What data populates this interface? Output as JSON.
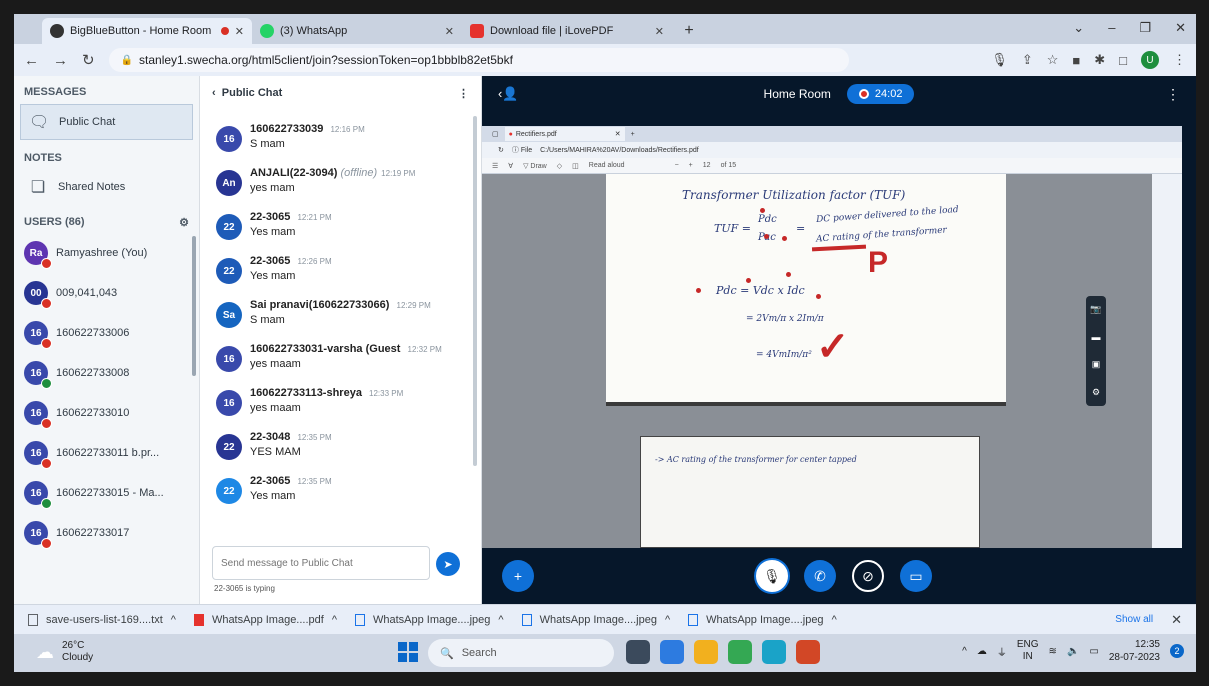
{
  "browser": {
    "tabs": [
      {
        "title": "BigBlueButton - Home Room",
        "active": true,
        "recording": true
      },
      {
        "title": "(3) WhatsApp",
        "active": false
      },
      {
        "title": "Download file | iLovePDF",
        "active": false
      }
    ],
    "url": "stanley1.swecha.org/html5client/join?sessionToken=op1bbblb82et5bkf"
  },
  "sidebar": {
    "messages_title": "MESSAGES",
    "public_chat": "Public Chat",
    "notes_title": "NOTES",
    "shared_notes": "Shared Notes",
    "users_title": "USERS (86)",
    "users": [
      {
        "initials": "Ra",
        "name": "Ramyashree (You)",
        "color": "#5e35b1",
        "mic": "muted"
      },
      {
        "initials": "00",
        "name": "009,041,043",
        "color": "#283593",
        "mic": "muted"
      },
      {
        "initials": "16",
        "name": "160622733006",
        "color": "#3949ab",
        "mic": "muted"
      },
      {
        "initials": "16",
        "name": "160622733008",
        "color": "#3949ab",
        "mic": "listen"
      },
      {
        "initials": "16",
        "name": "160622733010",
        "color": "#3949ab",
        "mic": "muted"
      },
      {
        "initials": "16",
        "name": "160622733011 b.pr...",
        "color": "#3949ab",
        "mic": "muted"
      },
      {
        "initials": "16",
        "name": "160622733015 - Ma...",
        "color": "#3949ab",
        "mic": "listen"
      },
      {
        "initials": "16",
        "name": "160622733017",
        "color": "#3949ab",
        "mic": "muted"
      }
    ]
  },
  "chat": {
    "header": "Public Chat",
    "messages": [
      {
        "initials": "16",
        "color": "#3949ab",
        "author": "160622733039",
        "time": "12:16 PM",
        "status": "",
        "text": "S mam"
      },
      {
        "initials": "An",
        "color": "#283593",
        "author": "ANJALI(22-3094)",
        "time": "12:19 PM",
        "status": "(offline)",
        "text": "yes mam"
      },
      {
        "initials": "22",
        "color": "#1e5bb8",
        "author": "22-3065",
        "time": "12:21 PM",
        "status": "",
        "text": "Yes mam"
      },
      {
        "initials": "22",
        "color": "#1e5bb8",
        "author": "22-3065",
        "time": "12:26 PM",
        "status": "",
        "text": "Yes mam"
      },
      {
        "initials": "Sa",
        "color": "#1565c0",
        "author": "Sai pranavi(160622733066)",
        "time": "12:29 PM",
        "status": "",
        "text": "S mam"
      },
      {
        "initials": "16",
        "color": "#3949ab",
        "author": "160622733031-varsha (Guest",
        "time": "12:32 PM",
        "status": "",
        "text": "yes maam"
      },
      {
        "initials": "16",
        "color": "#3949ab",
        "author": "160622733113-shreya",
        "time": "12:33 PM",
        "status": "",
        "text": "yes maam"
      },
      {
        "initials": "22",
        "color": "#283593",
        "author": "22-3048",
        "time": "12:35 PM",
        "status": "",
        "text": "YES MAM"
      },
      {
        "initials": "22",
        "color": "#1e88e5",
        "author": "22-3065",
        "time": "12:35 PM",
        "status": "",
        "text": "Yes mam"
      }
    ],
    "input_placeholder": "Send message to Public Chat",
    "typing": "22-3065 is typing"
  },
  "room": {
    "title": "Home Room",
    "recording_time": "24:02"
  },
  "screenshare": {
    "inner_tab": "Rectifiers.pdf",
    "inner_url": "C:/Users/MAHIRA%20AV/Downloads/Rectifiers.pdf",
    "page_number": "12",
    "page_total": "of 15",
    "draw_label": "Draw",
    "read_aloud_label": "Read aloud",
    "notes": [
      "Transformer Utilization factor (TUF)",
      "TUF =",
      "Pdc",
      "Pac",
      "=",
      "DC power delivered to the load",
      "AC rating of the transformer",
      "Pdc = Vdc x Idc",
      "= 2Vm/π x 2Im/π",
      "= 4VmIm/π²",
      "-> AC rating of the transformer for center tapped"
    ]
  },
  "downloads": [
    {
      "name": "save-users-list-169....txt",
      "type": "txt"
    },
    {
      "name": "WhatsApp Image....pdf",
      "type": "pdf"
    },
    {
      "name": "WhatsApp Image....jpeg",
      "type": "img"
    },
    {
      "name": "WhatsApp Image....jpeg",
      "type": "img"
    },
    {
      "name": "WhatsApp Image....jpeg",
      "type": "img"
    }
  ],
  "downloads_show_all": "Show all",
  "taskbar": {
    "temp": "26°C",
    "weather": "Cloudy",
    "search": "Search",
    "lang": "ENG",
    "region": "IN",
    "time": "12:35",
    "date": "28-07-2023"
  }
}
